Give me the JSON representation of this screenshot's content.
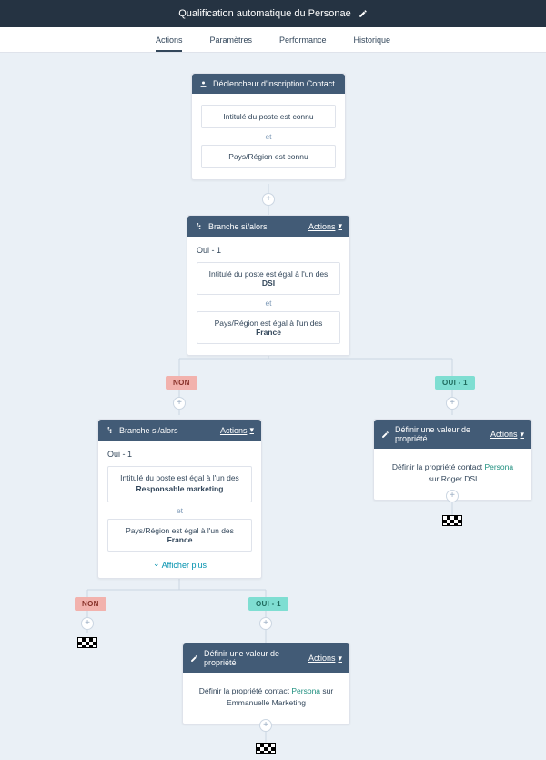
{
  "header": {
    "title": "Qualification automatique du Personae"
  },
  "tabs": {
    "items": [
      {
        "label": "Actions",
        "active": true
      },
      {
        "label": "Paramètres"
      },
      {
        "label": "Performance"
      },
      {
        "label": "Historique"
      }
    ]
  },
  "cards": {
    "trigger": {
      "header": "Déclencheur d'inscription Contact",
      "cond1": "Intitulé du poste est connu",
      "and": "et",
      "cond2": "Pays/Région est connu"
    },
    "branch1": {
      "header": "Branche si/alors",
      "actions": "Actions",
      "subtitle": "Oui - 1",
      "cond1_a": "Intitulé du poste est égal à l'un des ",
      "cond1_b": "DSI",
      "and": "et",
      "cond2_a": "Pays/Région est égal à l'un des ",
      "cond2_b": "France"
    },
    "branch2": {
      "header": "Branche si/alors",
      "actions": "Actions",
      "subtitle": "Oui - 1",
      "cond1_a": "Intitulé du poste est égal à l'un des",
      "cond1_b": "Responsable marketing",
      "and": "et",
      "cond2_a": "Pays/Région est égal à l'un des ",
      "cond2_b": "France",
      "show_more": "Afficher plus"
    },
    "set1": {
      "header": "Définir une valeur de propriété",
      "actions": "Actions",
      "text_a": "Définir la propriété contact ",
      "persona_label": "Persona",
      "text_b": " sur Roger DSI"
    },
    "set2": {
      "header": "Définir une valeur de propriété",
      "actions": "Actions",
      "text_a": "Définir la propriété contact ",
      "persona_label": "Persona",
      "text_b": " sur Emmanuelle Marketing"
    }
  },
  "labels": {
    "non": "NON",
    "oui": "OUI - 1"
  }
}
